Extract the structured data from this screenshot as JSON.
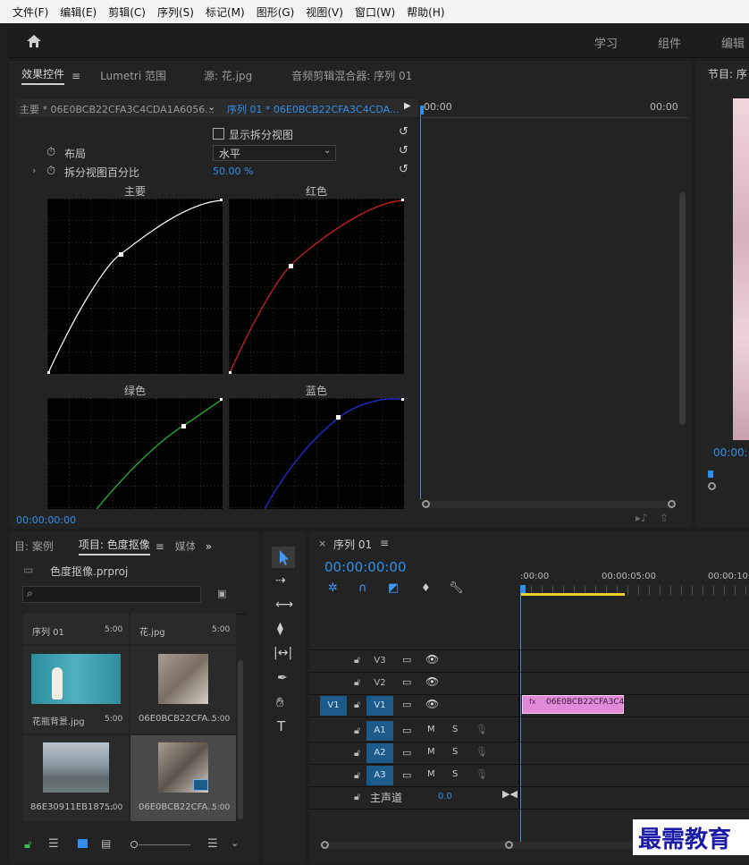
{
  "menu": [
    "文件(F)",
    "编辑(E)",
    "剪辑(C)",
    "序列(S)",
    "标记(M)",
    "图形(G)",
    "视图(V)",
    "窗口(W)",
    "帮助(H)"
  ],
  "workspaces": [
    "学习",
    "组件",
    "编辑"
  ],
  "effect_panel": {
    "tabs": [
      "效果控件",
      "Lumetri 范围",
      "源: 花.jpg",
      "音频剪辑混合器: 序列 01"
    ],
    "master_clip": "主要 * 06E0BCB22CFA3C4CDA1A6056...",
    "sequence_clip": "序列 01 * 06E0BCB22CFA3C4CDA...",
    "show_split": "显示拆分视图",
    "layout_label": "布局",
    "layout_value": "水平",
    "split_pct_label": "拆分视图百分比",
    "split_pct_value": "50.00 %",
    "graphs": [
      "主要",
      "红色",
      "绿色",
      "蓝色"
    ],
    "timecode_start": "00:00",
    "timecode_end": "00:00",
    "current_time": "00:00:00:00"
  },
  "program_monitor": {
    "title": "节目: 序",
    "timecode": "00:00:"
  },
  "project_panel": {
    "tabs": [
      "目: 案例",
      "项目: 色度抠像",
      "媒体"
    ],
    "project_file": "色度抠像.prproj",
    "search_placeholder": "",
    "items": [
      {
        "name": "序列 01",
        "dur": "5:00"
      },
      {
        "name": "花.jpg",
        "dur": "5:00"
      },
      {
        "name": "花瓶背景.jpg",
        "dur": "5:00"
      },
      {
        "name": "06E0BCB22CFA...",
        "dur": "5:00"
      },
      {
        "name": "86E30911EB187...",
        "dur": "5:00"
      },
      {
        "name": "06E0BCB22CFA...",
        "dur": "5:00"
      }
    ]
  },
  "timeline": {
    "title": "序列 01",
    "timecode": "00:00:00:00",
    "ruler": [
      ":00:00",
      "00:00:05:00",
      "00:00:10:"
    ],
    "video_tracks": [
      "V3",
      "V2",
      "V1"
    ],
    "audio_tracks": [
      "A1",
      "A2",
      "A3"
    ],
    "source_patch": "V1",
    "master": "主声道",
    "master_value": "0.0",
    "clip_label": "06E0BCB22CFA3C4",
    "m_label": "M",
    "s_label": "S"
  },
  "watermark": "最需教育",
  "colors": {
    "accent": "#2f8fea",
    "track_blue": "#1c5a8a",
    "clip": "#e08ad8",
    "yellow": "#e8d12a"
  }
}
